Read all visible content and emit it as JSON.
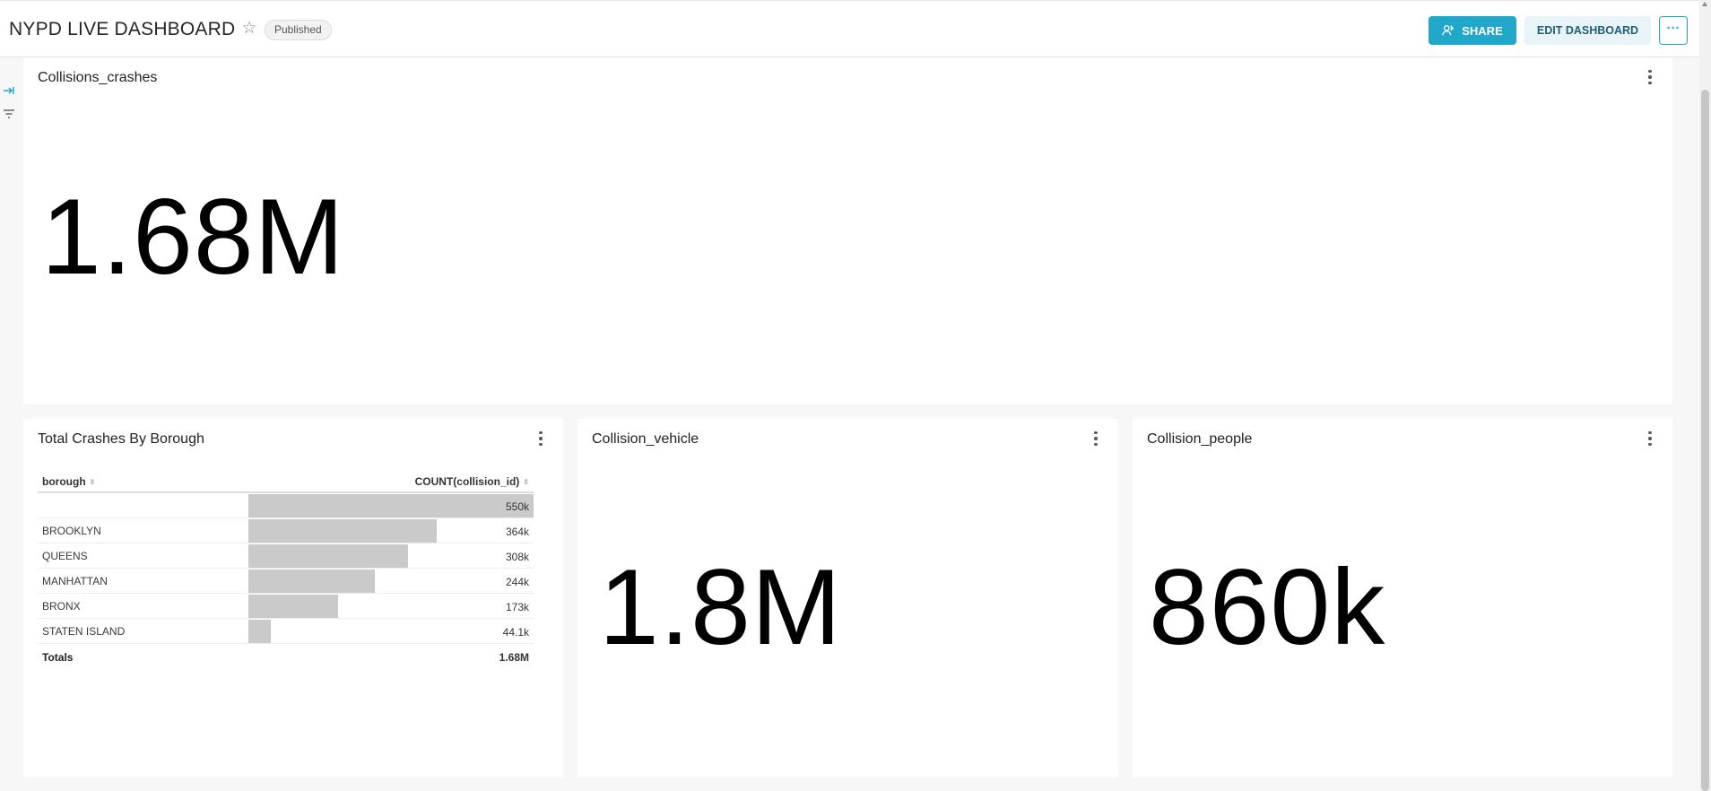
{
  "header": {
    "title": "NYPD LIVE DASHBOARD",
    "status_badge": "Published",
    "share_label": "SHARE",
    "edit_label": "EDIT DASHBOARD",
    "more_label": "···"
  },
  "panels": {
    "crashes": {
      "title": "Collisions_crashes",
      "value": "1.68M"
    },
    "borough": {
      "title": "Total Crashes By Borough",
      "columns": [
        "borough",
        "COUNT(collision_id)"
      ],
      "rows": [
        {
          "label": "",
          "value": "550k",
          "count": 550000
        },
        {
          "label": "BROOKLYN",
          "value": "364k",
          "count": 364000
        },
        {
          "label": "QUEENS",
          "value": "308k",
          "count": 308000
        },
        {
          "label": "MANHATTAN",
          "value": "244k",
          "count": 244000
        },
        {
          "label": "BRONX",
          "value": "173k",
          "count": 173000
        },
        {
          "label": "STATEN ISLAND",
          "value": "44.1k",
          "count": 44100
        }
      ],
      "totals_label": "Totals",
      "totals_value": "1.68M"
    },
    "vehicle": {
      "title": "Collision_vehicle",
      "value": "1.8M"
    },
    "people": {
      "title": "Collision_people",
      "value": "860k"
    }
  },
  "icons": {
    "star": "star-icon",
    "share": "share-icon",
    "expand": "expand-sidebar-icon",
    "filter": "filter-icon",
    "menu": "vertical-dots-icon",
    "sort": "sort-icon"
  },
  "colors": {
    "accent": "#20a7c9",
    "bar": "#cacaca"
  }
}
